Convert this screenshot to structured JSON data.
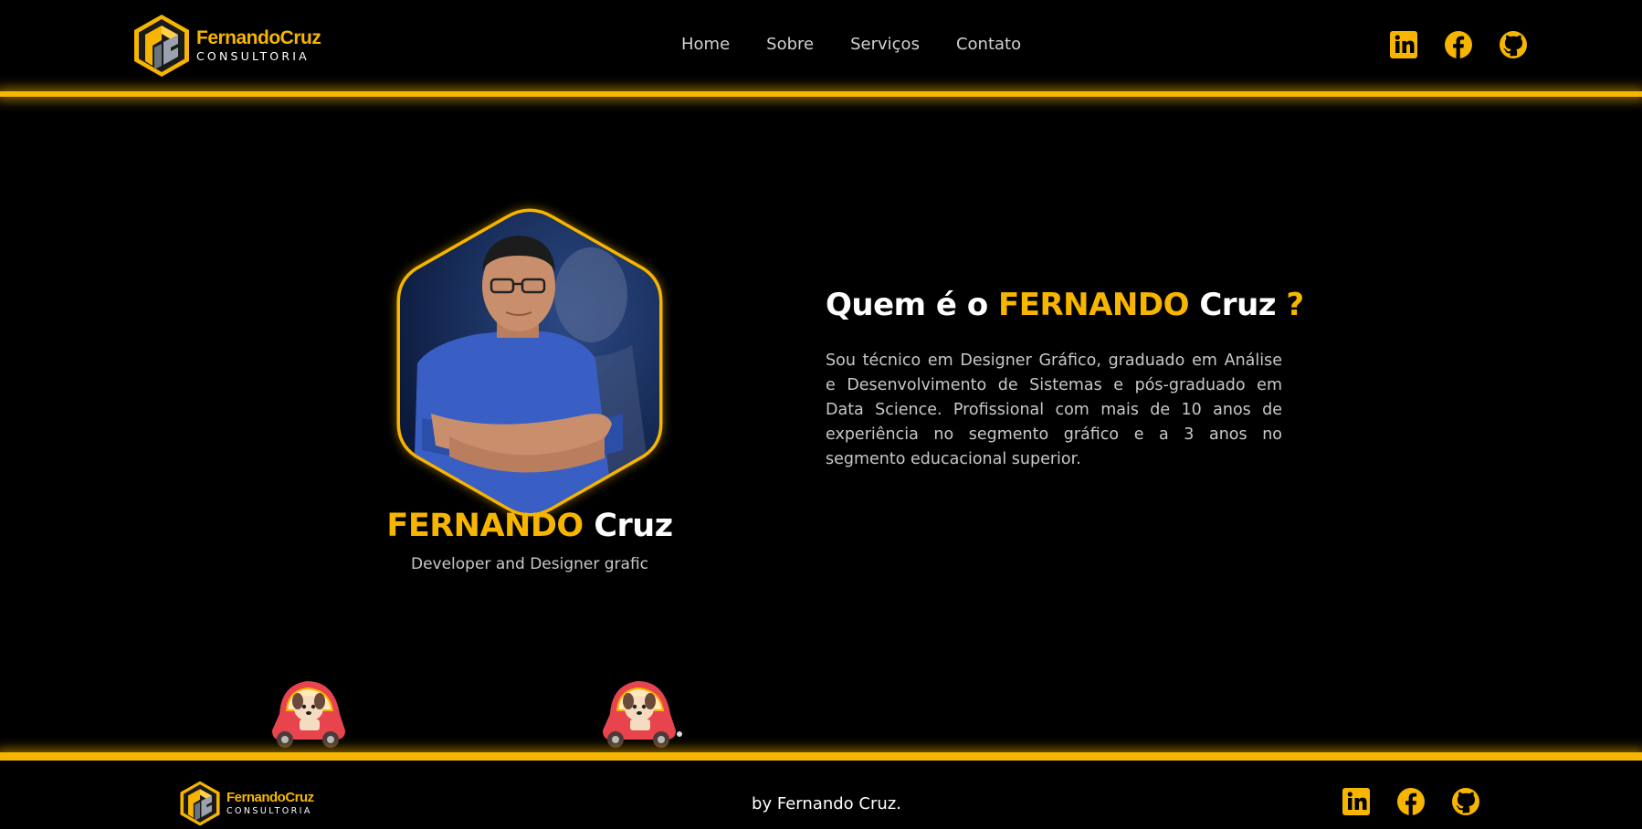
{
  "brand": {
    "name": "FernandoCruz",
    "tagline": "CONSULTORIA",
    "accent_color": "#f7b500"
  },
  "nav": {
    "items": [
      {
        "label": "Home"
      },
      {
        "label": "Sobre"
      },
      {
        "label": "Serviços"
      },
      {
        "label": "Contato"
      }
    ]
  },
  "social": {
    "icons": [
      "linkedin-icon",
      "facebook-icon",
      "github-icon"
    ]
  },
  "profile": {
    "first_name": "FERNANDO",
    "last_name": "Cruz",
    "role": "Developer and Designer grafic"
  },
  "about": {
    "title_prefix": "Quem é o",
    "title_highlight": "FERNANDO",
    "title_suffix": "Cruz",
    "title_mark": "?",
    "text": "Sou técnico em Designer Gráfico, graduado em Análise e Desenvolvimento de Sistemas e pós-graduado em Data Science. Profissional com mais de 10 anos de experiência no segmento gráfico e a 3 anos no segmento educacional superior."
  },
  "footer": {
    "credit": "by Fernando Cruz."
  }
}
